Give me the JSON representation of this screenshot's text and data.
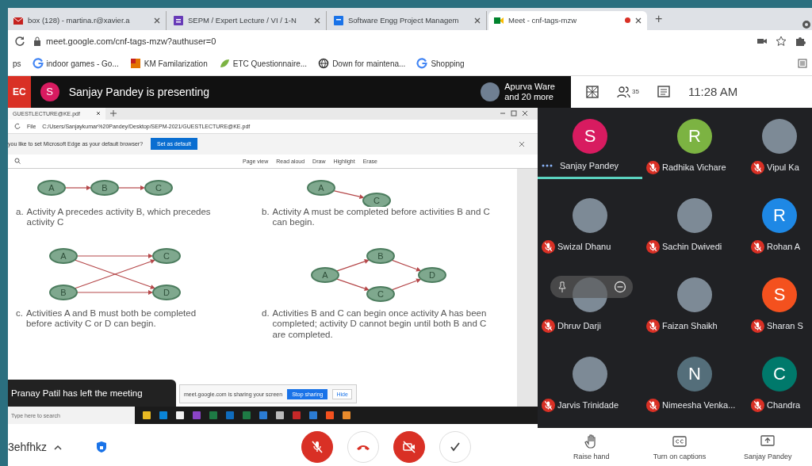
{
  "browser": {
    "tabs": [
      {
        "title": "box (128) - martina.r@xavier.a",
        "kind": "mail",
        "selected": false,
        "recording": false
      },
      {
        "title": "SEPM / Expert Lecture / VI / 1-N",
        "kind": "form",
        "selected": false,
        "recording": false
      },
      {
        "title": "Software Engg Project Managem",
        "kind": "doc",
        "selected": false,
        "recording": false
      },
      {
        "title": "Meet - cnf-tags-mzw",
        "kind": "meet",
        "selected": true,
        "recording": true
      }
    ],
    "new_tab": "+",
    "url": "meet.google.com/cnf-tags-mzw?authuser=0",
    "bookmarks": [
      {
        "label": "ps",
        "kind": "apps"
      },
      {
        "label": "indoor games - Go...",
        "kind": "google"
      },
      {
        "label": "KM Familarization",
        "kind": "folder"
      },
      {
        "label": "ETC Questionnaire...",
        "kind": "leaf"
      },
      {
        "label": "Down for maintena...",
        "kind": "globe"
      },
      {
        "label": "Shopping",
        "kind": "google"
      }
    ]
  },
  "meet_header": {
    "badge": "EC",
    "presenter_initial": "S",
    "presenting": "Sanjay Pandey is presenting",
    "others_name": "Apurva Ware",
    "others_more": "and 20 more",
    "people_count": "35",
    "time": "11:28 AM"
  },
  "shared_screen": {
    "tab_title": "GUESTLECTURE@KE.pdf",
    "file_label": "File",
    "path": "C:/Users/Sanjaykumar%20Pandey/Desktop/SEPM-2021/GUESTLECTURE@KE.pdf",
    "infobar": {
      "text": "you like to set Microsoft Edge as your default browser?",
      "button": "Set as default"
    },
    "toolbar": [
      "Page view",
      "Read aloud",
      "Draw",
      "Highlight",
      "Erase"
    ],
    "diagrams": [
      {
        "kind": "chain",
        "marker": "a.",
        "nodes": [
          "A",
          "B",
          "C"
        ],
        "caption": "Activity A precedes activity B, which precedes activity C"
      },
      {
        "kind": "fork",
        "marker": "b.",
        "nodes": [
          "A",
          "C"
        ],
        "caption": "Activity A must be completed before activities B and C can begin."
      },
      {
        "kind": "cross",
        "marker": "c.",
        "nodes": [
          "A",
          "B",
          "C",
          "D"
        ],
        "caption": "Activities A and B must both be completed before activity C or D can begin."
      },
      {
        "kind": "diamond",
        "marker": "d.",
        "nodes": [
          "A",
          "B",
          "C",
          "D"
        ],
        "caption": "Activities B and C can begin once activity A has been completed; activity D cannot begin until both B and C are completed."
      }
    ],
    "taskbar": {
      "search_placeholder": "Type here to search"
    }
  },
  "notification": "Pranay Patil has left the meeting",
  "sharing_bar": {
    "text": "meet.google.com is sharing your screen",
    "stop": "Stop sharing",
    "hide": "Hide"
  },
  "participants": [
    {
      "name": "Sanjay Pandey",
      "kind": "letter",
      "initial": "S",
      "color": "#d81b60",
      "muted": false,
      "speaking": true,
      "hovered": false
    },
    {
      "name": "Radhika Vichare",
      "kind": "letter",
      "initial": "R",
      "color": "#7cb342",
      "muted": true,
      "speaking": false,
      "hovered": false
    },
    {
      "name": "Vipul Ka",
      "kind": "photo",
      "muted": true,
      "speaking": false,
      "hovered": false
    },
    {
      "name": "Swizal Dhanu",
      "kind": "photo",
      "muted": true,
      "speaking": false,
      "hovered": false
    },
    {
      "name": "Sachin Dwivedi",
      "kind": "photo",
      "muted": true,
      "speaking": false,
      "hovered": false
    },
    {
      "name": "Rohan A",
      "kind": "letter",
      "initial": "R",
      "color": "#1e88e5",
      "muted": true,
      "speaking": false,
      "hovered": false
    },
    {
      "name": "Dhruv Darji",
      "kind": "photo",
      "muted": true,
      "speaking": false,
      "hovered": true
    },
    {
      "name": "Faizan Shaikh",
      "kind": "photo",
      "muted": true,
      "speaking": false,
      "hovered": false
    },
    {
      "name": "Sharan S",
      "kind": "letter",
      "initial": "S",
      "color": "#f4511e",
      "muted": true,
      "speaking": false,
      "hovered": false
    },
    {
      "name": "Jarvis Trinidade",
      "kind": "photo",
      "muted": true,
      "speaking": false,
      "hovered": false
    },
    {
      "name": "Nimeesha Venka...",
      "kind": "letter",
      "initial": "N",
      "color": "#546e7a",
      "muted": true,
      "speaking": false,
      "hovered": false
    },
    {
      "name": "Chandra",
      "kind": "letter",
      "initial": "C",
      "color": "#00796b",
      "muted": true,
      "speaking": false,
      "hovered": false
    }
  ],
  "meeting_code": "3ehfhkz",
  "controls": [
    {
      "kind": "mic",
      "off": true
    },
    {
      "kind": "hangup",
      "off": false
    },
    {
      "kind": "camera",
      "off": true
    },
    {
      "kind": "check",
      "off": false
    }
  ],
  "actions": [
    {
      "kind": "hand",
      "label": "Raise hand"
    },
    {
      "kind": "captions",
      "label": "Turn on captions"
    },
    {
      "kind": "present",
      "label": "Sanjay Pandey"
    }
  ]
}
